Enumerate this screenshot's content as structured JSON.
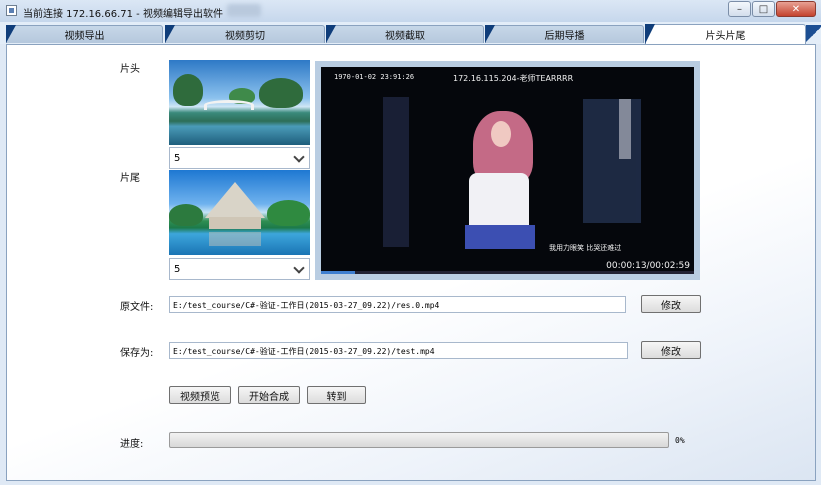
{
  "window": {
    "title": "当前连接 172.16.66.71  -  视频编辑导出软件",
    "min_glyph": "–",
    "max_glyph": "□",
    "close_glyph": "✕"
  },
  "tabs": [
    {
      "label": "视频导出"
    },
    {
      "label": "视频剪切"
    },
    {
      "label": "视频截取"
    },
    {
      "label": "后期导播"
    },
    {
      "label": "片头片尾",
      "active": true
    }
  ],
  "intro": {
    "label": "片头",
    "selected": "5"
  },
  "outro": {
    "label": "片尾",
    "selected": "5"
  },
  "preview": {
    "timestamp": "1970-01-02 23:91:26",
    "caption": "172.16.115.204-老师TEARRRR",
    "subtitle": "我用力眼笑 比哭还难过",
    "time": "00:00:13/00:02:59",
    "progress_fraction": 0.09
  },
  "source": {
    "label": "原文件:",
    "value": "E:/test_course/C#-验证-工作日(2015-03-27_09.22)/res.0.mp4",
    "button": "修改"
  },
  "save_as": {
    "label": "保存为:",
    "value": "E:/test_course/C#-验证-工作日(2015-03-27_09.22)/test.mp4",
    "button": "修改"
  },
  "actions": {
    "preview": "视频预览",
    "compose": "开始合成",
    "goto": "转到"
  },
  "progress": {
    "label": "进度:",
    "value": 0,
    "text": "0%"
  },
  "colors": {
    "tab_accent": "#0f3d7a",
    "progress_fill": "#4fb04b"
  }
}
